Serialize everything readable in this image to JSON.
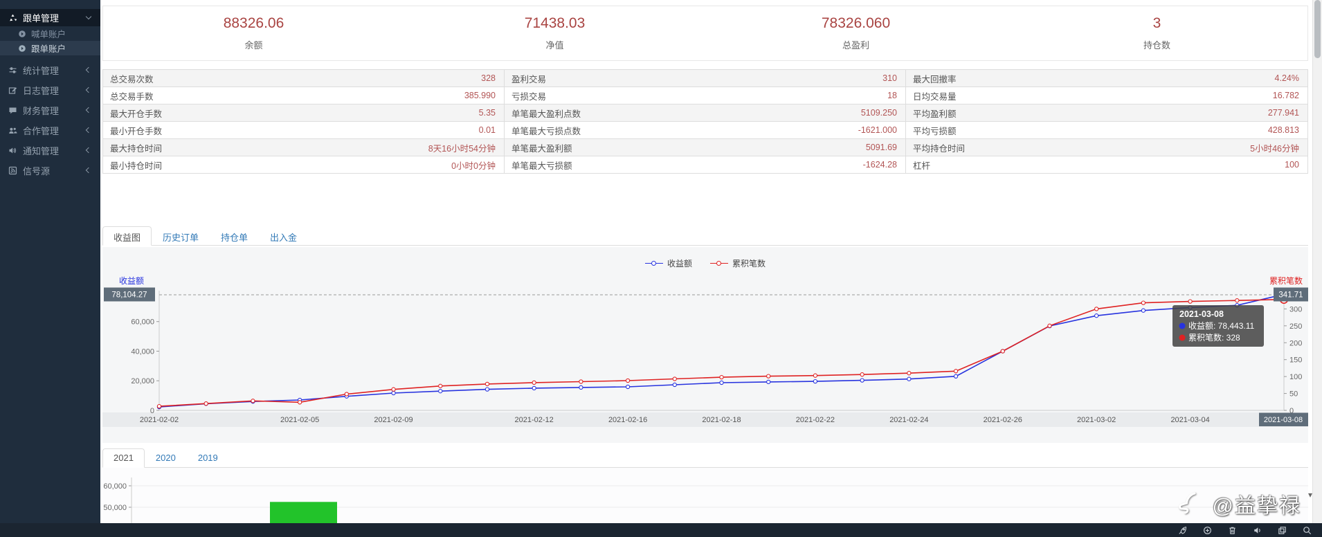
{
  "app": {
    "accent_red": "#a94442",
    "accent_blue": "#337ab7",
    "sidebar_bg": "#1f2d3d",
    "badge_bg": "#5f6d7a"
  },
  "sidebar": {
    "items": [
      {
        "label": "跟单管理",
        "icon": "recycle-icon",
        "active": true,
        "expanded": true,
        "children": [
          {
            "label": "喊单账户",
            "icon": "circle-arrow-icon",
            "active": false
          },
          {
            "label": "跟单账户",
            "icon": "circle-arrow-icon",
            "active": true
          }
        ]
      },
      {
        "label": "统计管理",
        "icon": "sliders-icon"
      },
      {
        "label": "日志管理",
        "icon": "edit-icon"
      },
      {
        "label": "财务管理",
        "icon": "comment-icon"
      },
      {
        "label": "合作管理",
        "icon": "users-icon"
      },
      {
        "label": "通知管理",
        "icon": "speaker-icon"
      },
      {
        "label": "信号源",
        "icon": "signal-icon"
      }
    ]
  },
  "stats": {
    "items": [
      {
        "value": "88326.06",
        "label": "余额"
      },
      {
        "value": "71438.03",
        "label": "净值"
      },
      {
        "value": "78326.060",
        "label": "总盈利"
      },
      {
        "value": "3",
        "label": "持仓数"
      }
    ]
  },
  "metrics_table": {
    "rows": [
      [
        {
          "label": "总交易次数",
          "value": "328"
        },
        {
          "label": "盈利交易",
          "value": "310"
        },
        {
          "label": "最大回撤率",
          "value": "4.24%"
        }
      ],
      [
        {
          "label": "总交易手数",
          "value": "385.990"
        },
        {
          "label": "亏损交易",
          "value": "18"
        },
        {
          "label": "日均交易量",
          "value": "16.782"
        }
      ],
      [
        {
          "label": "最大开仓手数",
          "value": "5.35"
        },
        {
          "label": "单笔最大盈利点数",
          "value": "5109.250"
        },
        {
          "label": "平均盈利额",
          "value": "277.941"
        }
      ],
      [
        {
          "label": "最小开仓手数",
          "value": "0.01"
        },
        {
          "label": "单笔最大亏损点数",
          "value": "-1621.000"
        },
        {
          "label": "平均亏损额",
          "value": "428.813"
        }
      ],
      [
        {
          "label": "最大持仓时间",
          "value": "8天16小时54分钟"
        },
        {
          "label": "单笔最大盈利额",
          "value": "5091.69"
        },
        {
          "label": "平均持仓时间",
          "value": "5小时46分钟"
        }
      ],
      [
        {
          "label": "最小持仓时间",
          "value": "0小时0分钟"
        },
        {
          "label": "单笔最大亏损额",
          "value": "-1624.28"
        },
        {
          "label": "杠杆",
          "value": "100"
        }
      ]
    ]
  },
  "tabs": {
    "items": [
      {
        "label": "收益图",
        "active": true
      },
      {
        "label": "历史订单",
        "active": false
      },
      {
        "label": "持仓单",
        "active": false
      },
      {
        "label": "出入金",
        "active": false
      }
    ]
  },
  "year_tabs": {
    "items": [
      {
        "label": "2021",
        "active": true
      },
      {
        "label": "2020",
        "active": false
      },
      {
        "label": "2019",
        "active": false
      }
    ]
  },
  "chart_data": [
    {
      "type": "line",
      "legend_position": "top-center",
      "grid": false,
      "x": [
        "2021-02-02",
        "2021-02-03",
        "2021-02-04",
        "2021-02-05",
        "2021-02-08",
        "2021-02-09",
        "2021-02-10",
        "2021-02-11",
        "2021-02-12",
        "2021-02-15",
        "2021-02-16",
        "2021-02-17",
        "2021-02-18",
        "2021-02-19",
        "2021-02-22",
        "2021-02-23",
        "2021-02-24",
        "2021-02-25",
        "2021-02-26",
        "2021-03-01",
        "2021-03-02",
        "2021-03-03",
        "2021-03-04",
        "2021-03-05",
        "2021-03-08"
      ],
      "x_tick_labels": [
        "2021-02-02",
        "2021-02-05",
        "2021-02-09",
        "2021-02-12",
        "2021-02-16",
        "2021-02-18",
        "2021-02-22",
        "2021-02-24",
        "2021-02-26",
        "2021-03-02",
        "2021-03-04",
        "2021-03-08"
      ],
      "series": [
        {
          "name": "收益额",
          "color": "#2733df",
          "axis": "left",
          "values": [
            2300,
            4500,
            6000,
            7000,
            9500,
            11700,
            13000,
            14200,
            15000,
            15500,
            15900,
            17300,
            18700,
            19200,
            19600,
            20300,
            21200,
            23000,
            40000,
            57000,
            64000,
            67500,
            69500,
            71000,
            78443.11
          ]
        },
        {
          "name": "累积笔数",
          "color": "#df2222",
          "axis": "right",
          "values": [
            12,
            20,
            28,
            24,
            48,
            62,
            72,
            78,
            82,
            85,
            88,
            93,
            98,
            101,
            103,
            106,
            110,
            116,
            175,
            250,
            300,
            318,
            322,
            325,
            328
          ]
        }
      ],
      "left_axis": {
        "title": "收益额",
        "ticks": [
          0,
          20000,
          40000,
          60000
        ],
        "tick_labels": [
          "0",
          "20,000",
          "40,000",
          "60,000"
        ],
        "max": 78104.27,
        "max_label": "78,104.27"
      },
      "right_axis": {
        "title": "累积笔数",
        "ticks": [
          0,
          50,
          100,
          150,
          200,
          250,
          300
        ],
        "tick_labels": [
          "0",
          "50",
          "100",
          "150",
          "200",
          "250",
          "300"
        ],
        "max": 341.71,
        "max_label": "341.71"
      },
      "highlight_x": "2021-03-08",
      "tooltip": {
        "title": "2021-03-08",
        "rows": [
          {
            "series": "收益额",
            "value": "78,443.11"
          },
          {
            "series": "累积笔数",
            "value": "328"
          }
        ]
      }
    },
    {
      "type": "bar",
      "partial_view": true,
      "tick_labels": [
        "60,000",
        "50,000"
      ],
      "ticks": [
        60000,
        50000
      ],
      "bars": [
        {
          "value": 52500,
          "color": "#22c32a"
        }
      ]
    }
  ],
  "watermark": {
    "handle": "@益挚禄",
    "dropdown": "▾"
  },
  "taskbar": {
    "icons": [
      "rocket-icon",
      "compass-plus-icon",
      "trash-icon",
      "volume-icon",
      "windows-icon",
      "search-icon"
    ]
  }
}
